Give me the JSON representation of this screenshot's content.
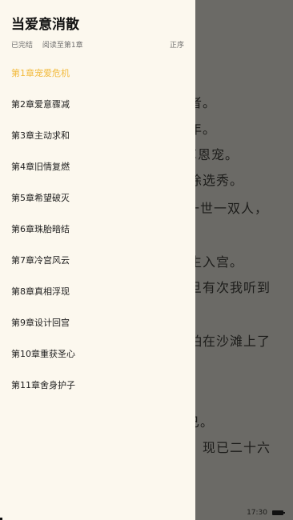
{
  "reader": {
    "lines": [
      "者。",
      "年。",
      "享恩宠。",
      "徐选秀。",
      "一世一双人，",
      "生入宫。",
      "旦有次我听到",
      "怕在沙滩上了",
      "已。",
      "现已二十六"
    ]
  },
  "status": {
    "time": "17:30"
  },
  "drawer": {
    "title": "当爱意消散",
    "status": "已完结",
    "progress": "阅读至第1章",
    "sort": "正序",
    "chapters": [
      "第1章宠爱危机",
      "第2章爱意骤减",
      "第3章主动求和",
      "第4章旧情复燃",
      "第5章希望破灭",
      "第6章珠胎暗结",
      "第7章冷宫风云",
      "第8章真相浮现",
      "第9章设计回宫",
      "第10章重获圣心",
      "第11章舍身护子"
    ],
    "active_index": 0
  },
  "colors": {
    "active_chapter": "#f2ba3c",
    "drawer_bg": "#fcf8ee",
    "overlay": "#6b6a66"
  }
}
